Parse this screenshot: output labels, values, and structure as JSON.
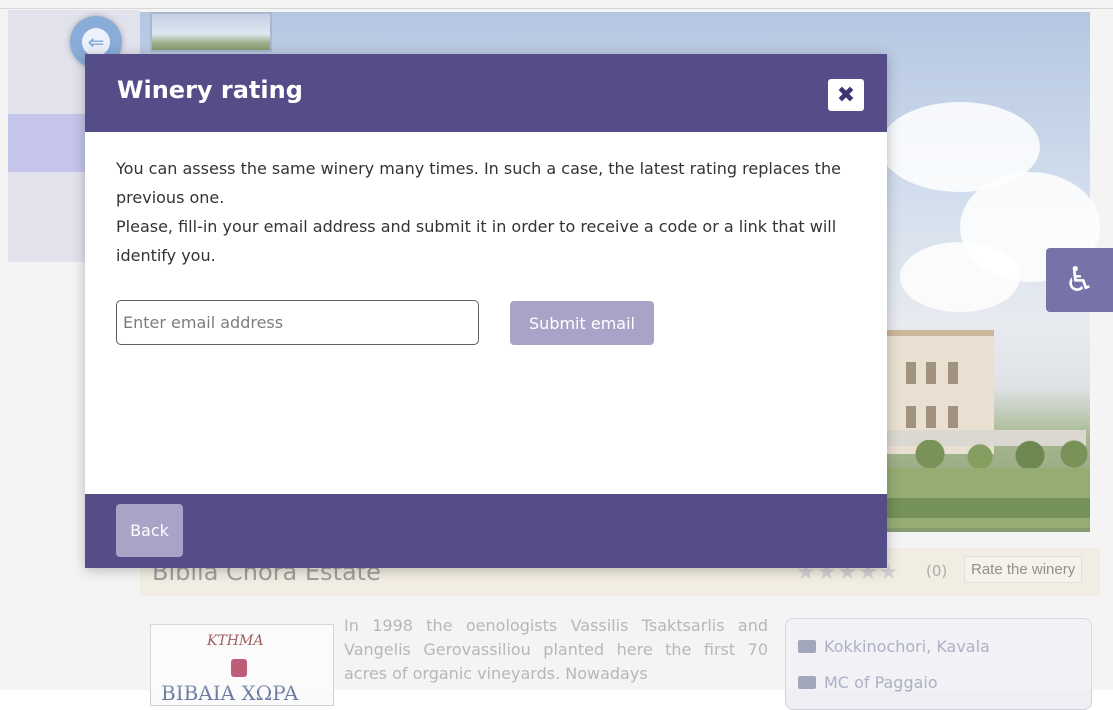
{
  "modal": {
    "title": "Winery rating",
    "close_icon": "✖",
    "paragraph_1": "You can assess the same winery many times. In such a case, the latest rating replaces the previous one.",
    "paragraph_2": "Please, fill-in your email address and submit it in order to receive a code or a link that will identify you.",
    "email_input": {
      "value": "",
      "placeholder": "Enter email address"
    },
    "submit_label": "Submit email",
    "back_label": "Back"
  },
  "background": {
    "winery_name": "Biblia Chora Estate",
    "stars": "★★★★★",
    "rating_count": "(0)",
    "rate_link": "Rate the winery",
    "description": "In 1998 the oenologists Vassilis Tsaktsarlis and Vangelis Gerovassiliou planted here the first 70 acres of organic vineyards. Nowadays",
    "info": [
      "Kokkinochori, Kavala",
      "MC of Paggaio"
    ],
    "logo_text_top": "KTHMA",
    "logo_text_bottom": "BIBAIA XΩPA",
    "back_arrow_glyph": "⇐",
    "accessibility_glyph": "♿"
  },
  "colors": {
    "modal_header": "#544d88",
    "button_muted": "#a8a4c7",
    "accessibility_button": "#5a5596"
  },
  "icons": {
    "close": "close-icon",
    "back_arrow": "back-arrow-icon",
    "accessibility": "accessibility-icon",
    "contact_card": "contact-card-icon",
    "star": "star-icon"
  }
}
